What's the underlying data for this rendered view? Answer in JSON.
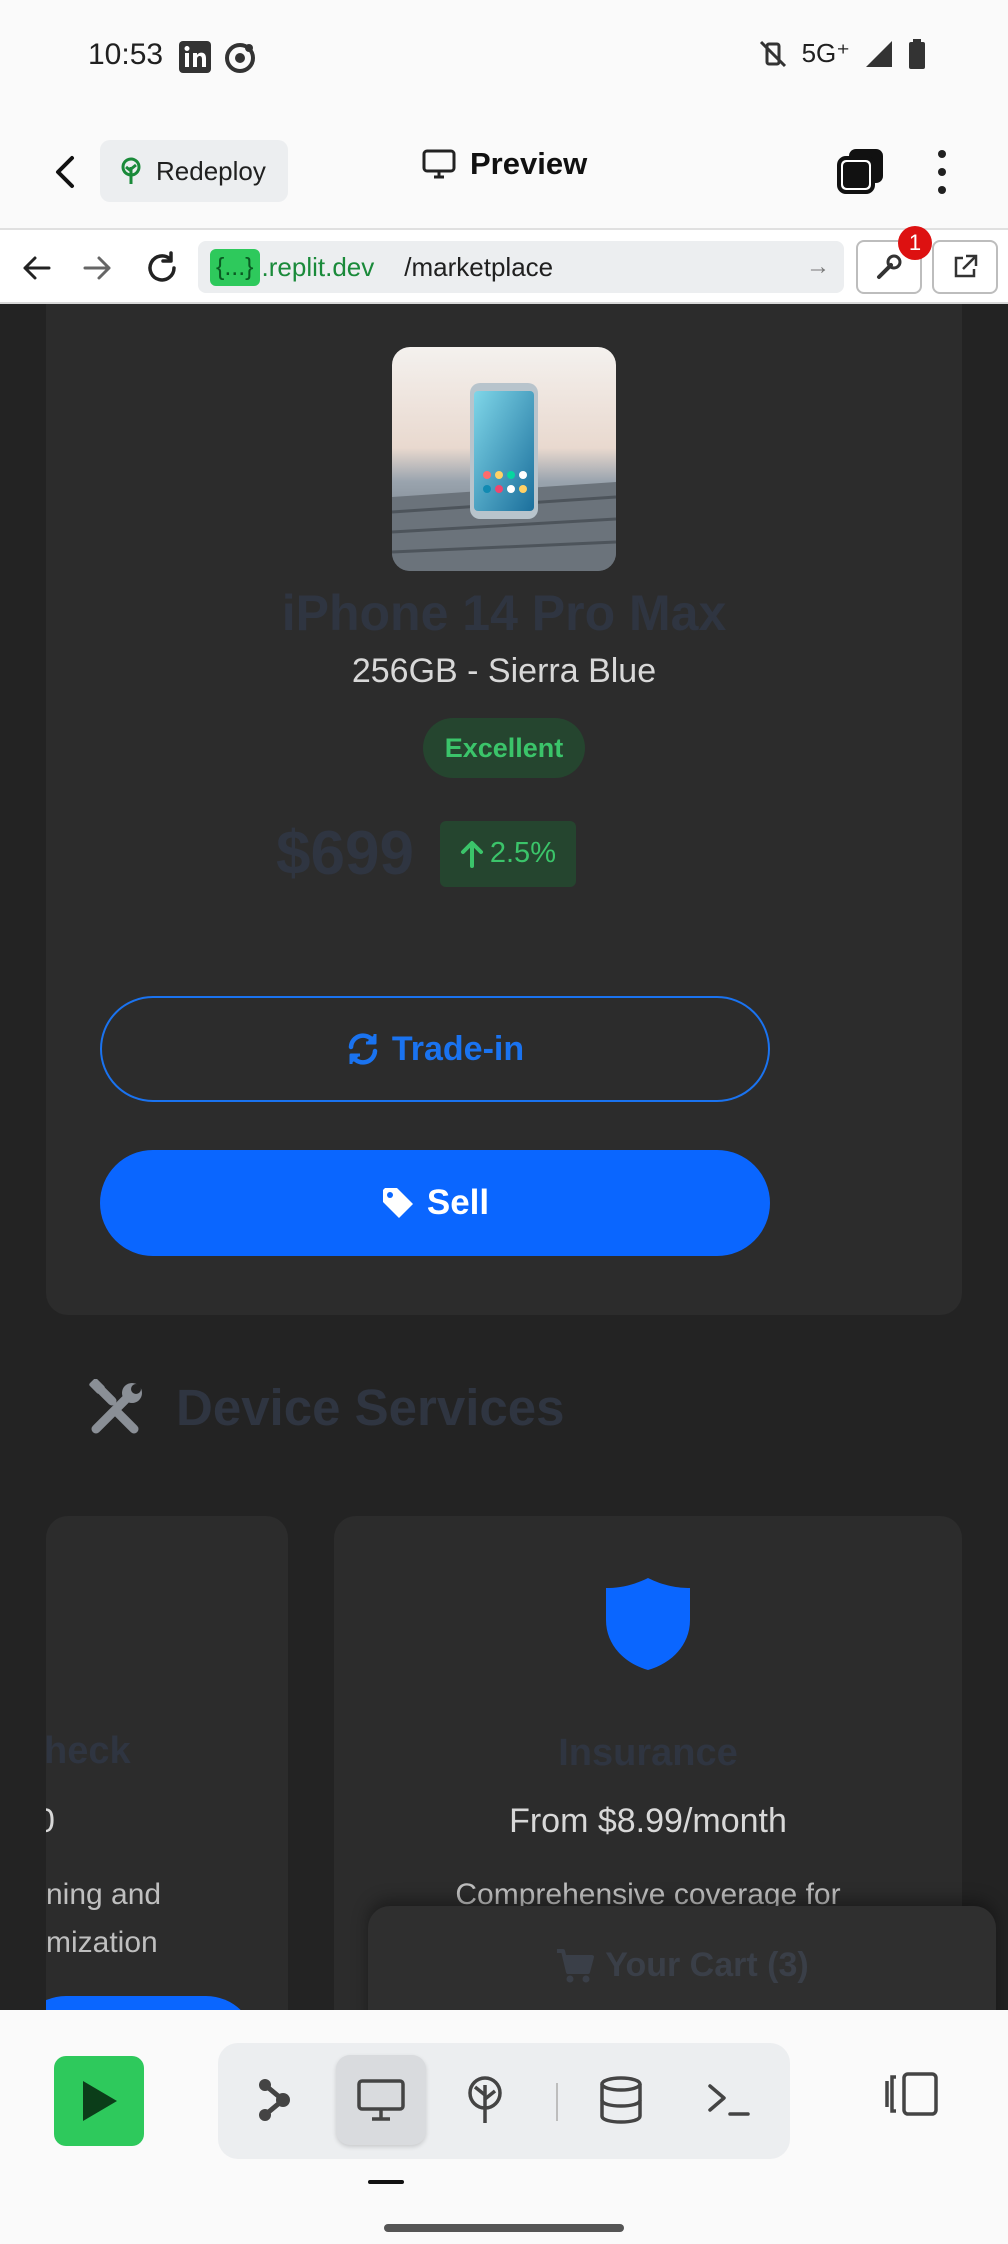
{
  "status_bar": {
    "time": "10:53",
    "network": "5G⁺"
  },
  "header": {
    "redeploy_label": "Redeploy",
    "preview_label": "Preview"
  },
  "browser": {
    "url_badge": "{...}",
    "url_domain": ".replit.dev",
    "url_path": "/marketplace",
    "devtools_badge": "1"
  },
  "product": {
    "name": "iPhone 14 Pro Max",
    "variant": "256GB - Sierra Blue",
    "condition": "Excellent",
    "price": "$699",
    "change": "2.5%",
    "tradein_label": "Trade-in",
    "sell_label": "Sell"
  },
  "services": {
    "title": "Device Services",
    "left_card": {
      "title": "heck",
      "price": "0",
      "desc_line1": "ning and",
      "desc_line2": "mization"
    },
    "right_card": {
      "title": "Insurance",
      "price": "From $8.99/month",
      "desc": "Comprehensive coverage for"
    }
  },
  "cart": {
    "label": "Your Cart (3)"
  },
  "colors": {
    "accent": "#0a66ff",
    "success": "#3bc46a",
    "run": "#2ec95c",
    "page_bg": "#232323"
  }
}
